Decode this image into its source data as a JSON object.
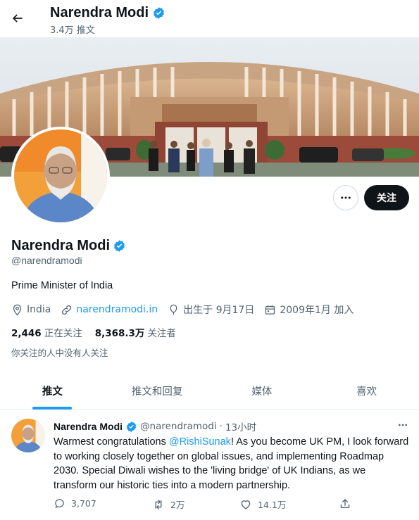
{
  "header": {
    "name": "Narendra Modi",
    "tweet_count": "3.4万 推文"
  },
  "profile": {
    "name": "Narendra Modi",
    "handle": "@narendramodi",
    "bio": "Prime Minister of India",
    "location": "India",
    "website": "narendramodi.in",
    "birthday": "出生于 9月17日",
    "joined": "2009年1月 加入",
    "following_count": "2,446",
    "following_label": "正在关注",
    "followers_count": "8,368.3万",
    "followers_label": "关注者",
    "mutual_note": "你关注的人中没有人关注"
  },
  "actions": {
    "follow_label": "关注"
  },
  "tabs": [
    {
      "label": "推文",
      "active": true
    },
    {
      "label": "推文和回复",
      "active": false
    },
    {
      "label": "媒体",
      "active": false
    },
    {
      "label": "喜欢",
      "active": false
    }
  ],
  "tweet": {
    "author": "Narendra Modi",
    "handle": "@narendramodi",
    "sep": "·",
    "time": "13小时",
    "text_before": "Warmest congratulations ",
    "mention": "@RishiSunak",
    "text_after": "! As you become UK PM, I look forward to working closely together on global issues, and implementing Roadmap 2030. Special Diwali wishes to the 'living bridge' of UK Indians, as we transform our historic ties into a modern partnership.",
    "replies": "3,707",
    "retweets": "2万",
    "likes": "14.1万"
  },
  "colors": {
    "accent": "#1d9bf0",
    "text": "#0f1419",
    "muted": "#536471",
    "verified": "#1d9bf0"
  },
  "icons": [
    "back-arrow-icon",
    "verified-badge-icon",
    "more-horizontal-icon",
    "location-icon",
    "link-icon",
    "birthday-balloon-icon",
    "calendar-icon",
    "reply-icon",
    "retweet-icon",
    "like-heart-icon",
    "share-icon"
  ]
}
